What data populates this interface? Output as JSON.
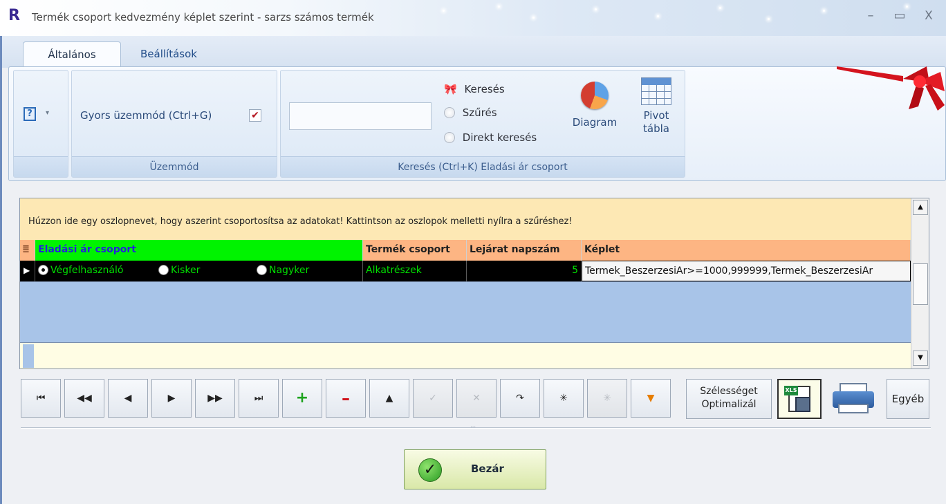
{
  "window": {
    "title": "Termék csoport kedvezmény képlet szerint - sarzs számos termék",
    "logo": "R",
    "minimize_glyph": "–",
    "maximize_glyph": "▭",
    "close_glyph": "X"
  },
  "tabs": [
    {
      "label": "Általános",
      "active": true
    },
    {
      "label": "Beállítások",
      "active": false
    }
  ],
  "ribbon": {
    "help_icon": "?",
    "help_arrow": "▾",
    "mode_group": {
      "label": "Gyors üzemmód (Ctrl+G)",
      "checked": true,
      "check_glyph": "✔",
      "caption": "Üzemmód"
    },
    "search_group": {
      "input_value": "",
      "radio_options": [
        {
          "label": "Keresés",
          "selected": true,
          "icon": "bow-icon"
        },
        {
          "label": "Szűrés",
          "selected": false
        },
        {
          "label": "Direkt keresés",
          "selected": false
        }
      ],
      "diagram_label": "Diagram",
      "pivot_label_1": "Pivot",
      "pivot_label_2": "tábla",
      "caption": "Keresés (Ctrl+K) Eladási ár csoport"
    }
  },
  "grid": {
    "group_panel_text": "Húzzon ide egy oszlopnevet, hogy aszerint csoportosítsa az adatokat! Kattintson az oszlopok melletti nyílra a szűréshez!",
    "selector_glyph": "≣",
    "columns": [
      "Eladási ár csoport",
      "Termék csoport",
      "Lejárat napszám",
      "Képlet"
    ],
    "rows": [
      {
        "row_indicator": "▶",
        "elad_options": [
          {
            "label": "Végfelhasználó",
            "selected": true
          },
          {
            "label": "Kisker",
            "selected": false
          },
          {
            "label": "Nagyker",
            "selected": false
          }
        ],
        "termek_csoport": "Alkatrészek",
        "lejarat": "5",
        "keplet": "Termek_BeszerzesiAr>=1000,999999,Termek_BeszerzesiAr"
      }
    ],
    "scroll_up": "▲",
    "scroll_down": "▼"
  },
  "navigator": {
    "first": "⏮",
    "prev_page": "◀◀",
    "prev": "◀",
    "next": "▶",
    "next_page": "▶▶",
    "last": "⏭",
    "add": "+",
    "delete": "–",
    "edit": "▲",
    "post": "✓",
    "cancel": "✕",
    "refresh": "↷",
    "bookmark": "✳",
    "goto_bookmark": "✳",
    "filter": "▼",
    "optimize_line1": "Szélességet",
    "optimize_line2": "Optimalizál",
    "xls_badge": "XLS",
    "egyeb": "Egyéb"
  },
  "close_button": {
    "label": "Bezár",
    "check_glyph": "✓"
  },
  "colors": {
    "group_panel_bg": "#fde8b4",
    "header_green": "#00f300",
    "header_orange": "#fdb583",
    "row_text_green": "#00e000",
    "grid_empty_bg": "#a8c4e8"
  }
}
